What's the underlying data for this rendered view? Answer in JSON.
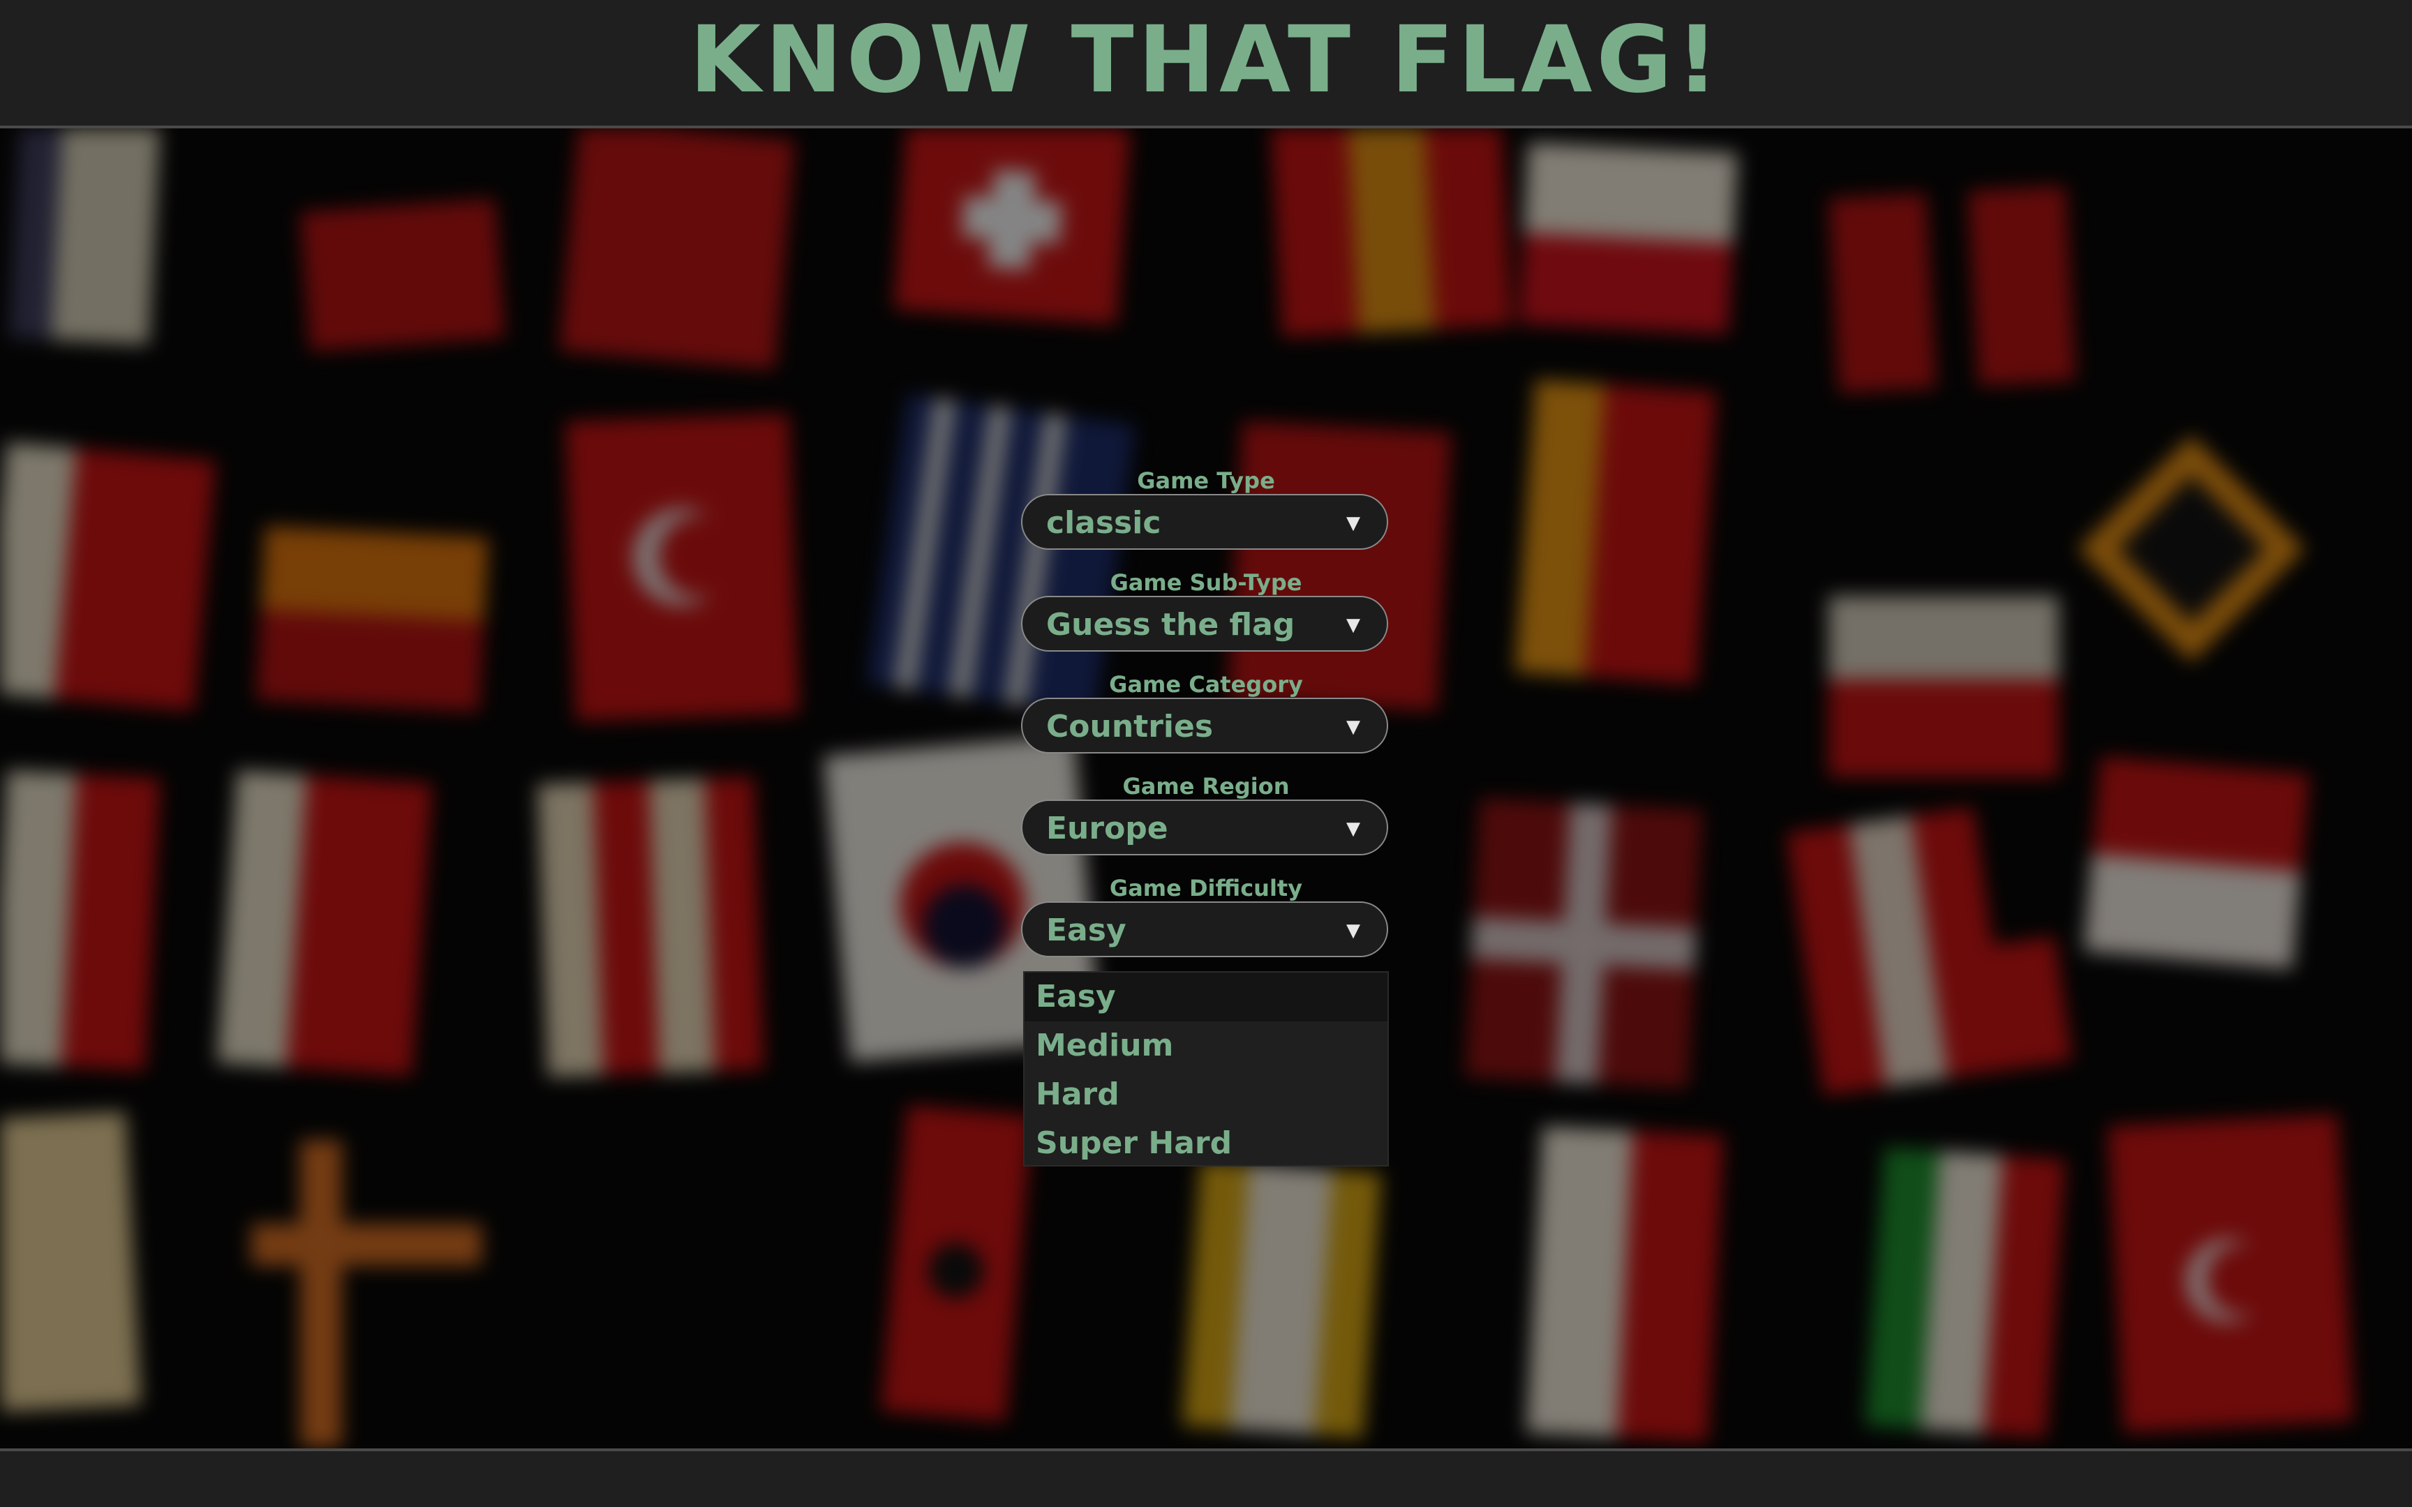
{
  "header": {
    "title": "KNOW THAT FLAG!"
  },
  "form": {
    "fields": [
      {
        "label": "Game Type",
        "value": "classic"
      },
      {
        "label": "Game Sub-Type",
        "value": "Guess the flag"
      },
      {
        "label": "Game Category",
        "value": "Countries"
      },
      {
        "label": "Game Region",
        "value": "Europe"
      },
      {
        "label": "Game Difficulty",
        "value": "Easy"
      }
    ],
    "chevron": "▼"
  },
  "dropdown": {
    "options": [
      "Easy",
      "Medium",
      "Hard",
      "Super Hard"
    ],
    "selected_index": 0
  },
  "colors": {
    "accent": "#7aae8b",
    "bar": "#1f1f1f",
    "border": "#8a8a8a"
  },
  "icons": {
    "chevron": "chevron-down-icon",
    "background": "flags-collage"
  }
}
